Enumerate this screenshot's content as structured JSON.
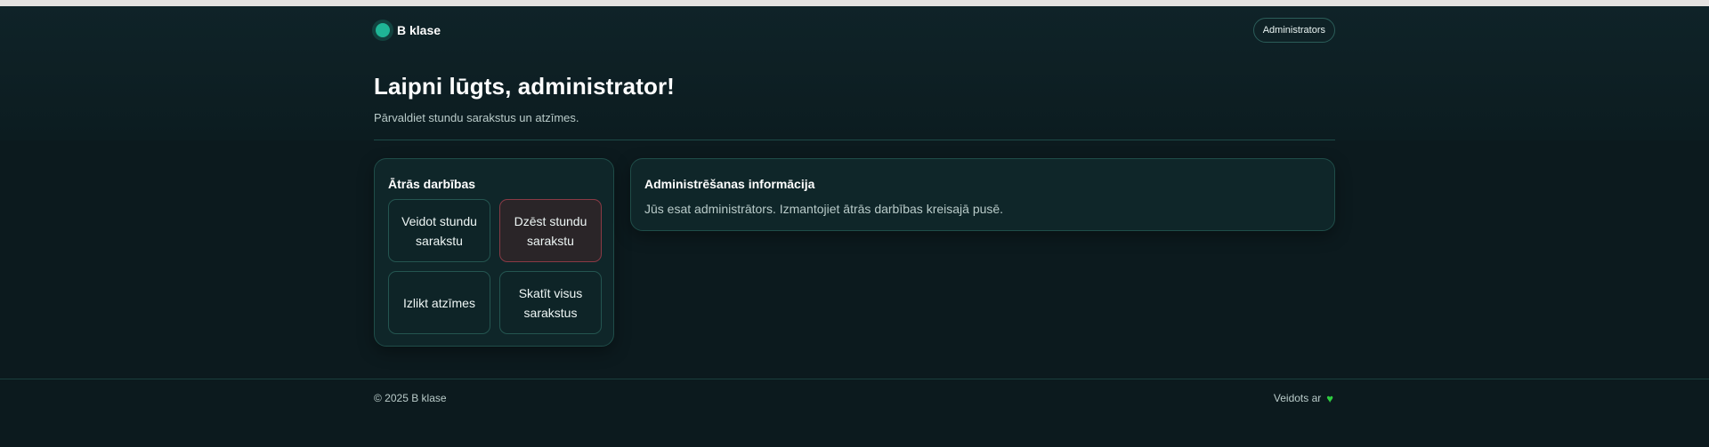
{
  "nav": {
    "brand": "B klase",
    "role": "Administrators"
  },
  "header": {
    "title": "Laipni lūgts, administrator!",
    "subtitle": "Pārvaldiet stundu sarakstus un atzīmes."
  },
  "quick_actions": {
    "title": "Ātrās darbības",
    "buttons": [
      {
        "label": "Veidot stundu sarakstu"
      },
      {
        "label": "Dzēst stundu sarakstu"
      },
      {
        "label": "Izlikt atzīmes"
      },
      {
        "label": "Skatīt visus sarakstus"
      }
    ]
  },
  "info": {
    "title": "Administrēšanas informācija",
    "text": "Jūs esat administrātors. Izmantojiet ātrās darbības kreisajā pusē."
  },
  "footer": {
    "copyright": "© 2025 B klase",
    "made_with": "Veidots ar",
    "heart_icon": "heart-icon"
  },
  "colors": {
    "accent": "#1fb596",
    "danger": "#8a3a45",
    "heart": "#2ecc40"
  }
}
